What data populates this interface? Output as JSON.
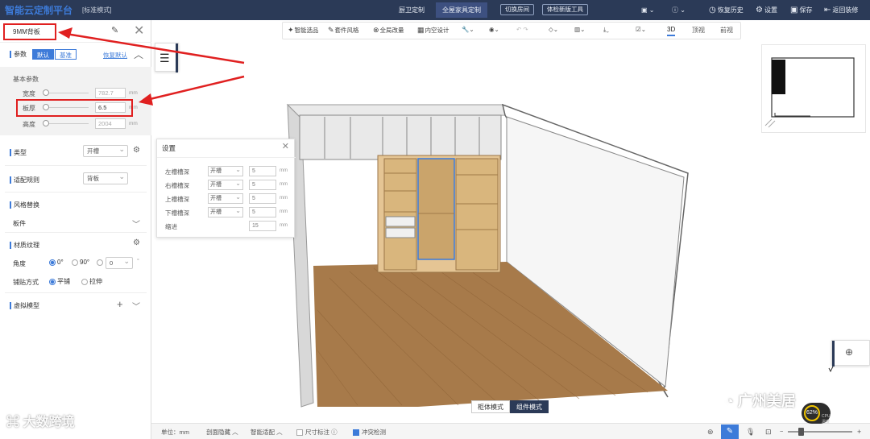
{
  "topbar": {
    "brand": "智能云定制平台",
    "mode": "[标准模式]",
    "tabs": [
      "厨卫定制",
      "全屋家具定制"
    ],
    "active_tab": 1,
    "buttons": [
      "切换房间",
      "体检新版工具"
    ],
    "right": {
      "restore": "恢复历史",
      "settings": "设置",
      "save": "保存",
      "back": "返回装修"
    }
  },
  "left_panel": {
    "title": "9MM背板",
    "params": {
      "label": "参数",
      "seg_on": "默认",
      "seg_off": "基准",
      "reset": "恢复默认"
    },
    "basic": {
      "title": "基本参数",
      "rows": [
        {
          "label": "宽度",
          "value": "782.7",
          "unit": "mm"
        },
        {
          "label": "板厚",
          "value": "6.5",
          "unit": "mm"
        },
        {
          "label": "高度",
          "value": "2004",
          "unit": "mm"
        }
      ]
    },
    "type": {
      "label": "类型",
      "value": "开槽"
    },
    "rule": {
      "label": "适配规则",
      "value": "背板"
    },
    "style": {
      "label": "风格替换",
      "sub": "板件"
    },
    "material": {
      "label": "材质纹理",
      "angle_label": "角度",
      "angles": [
        "0°",
        "90°"
      ],
      "angle_custom": "0",
      "angle_unit": "°",
      "paste_label": "铺贴方式",
      "paste_opts": [
        "平铺",
        "拉伸"
      ]
    },
    "virtual": "虚拟模型"
  },
  "viewport_toolbar": {
    "items": [
      "智能选品",
      "套件风格",
      "全局改量",
      "内空设计"
    ],
    "view_tabs": [
      "3D",
      "顶视",
      "前视"
    ],
    "active_view": 0
  },
  "settings_popup": {
    "title": "设置",
    "rows": [
      {
        "label": "左槽槽深",
        "mode": "开槽",
        "value": "5",
        "unit": "mm"
      },
      {
        "label": "右槽槽深",
        "mode": "开槽",
        "value": "5",
        "unit": "mm"
      },
      {
        "label": "上槽槽深",
        "mode": "开槽",
        "value": "5",
        "unit": "mm"
      },
      {
        "label": "下槽槽深",
        "mode": "开槽",
        "value": "5",
        "unit": "mm"
      }
    ],
    "inset": {
      "label": "缩进",
      "value": "15",
      "unit": "mm"
    }
  },
  "modes": [
    "柜体模式",
    "组件模式"
  ],
  "active_mode": 1,
  "statusbar": {
    "unit": "单位：mm",
    "section": "剖面隐藏",
    "adapt": "智能适配",
    "dim": "尺寸标注",
    "conflict": "冲突检测"
  },
  "cpu": {
    "percent": "62%",
    "label": "CPU温度"
  },
  "watermark_left": "大数跨境",
  "watermark_right": "广州美居"
}
